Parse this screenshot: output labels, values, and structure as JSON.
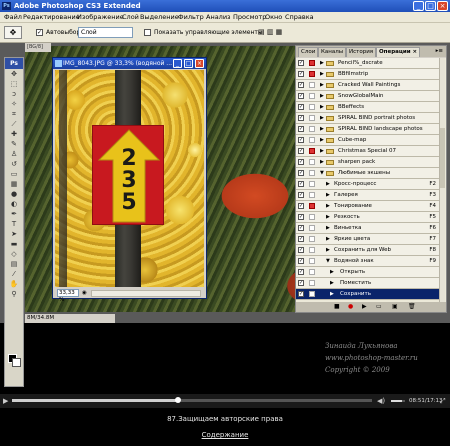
{
  "app": {
    "title": "Adobe Photoshop CS3 Extended",
    "logo": "Ps",
    "window_buttons": [
      "_",
      "□",
      "×"
    ]
  },
  "menu": [
    "Файл",
    "Редактирование",
    "Изображение",
    "Слой",
    "Выделение",
    "Фильтр",
    "Анализ",
    "Просмотр",
    "Окно",
    "Справка"
  ],
  "options": {
    "autoselect_label": "Автовыбор:",
    "autoselect_value": "Слой",
    "show_transform_label": "Показать управляющие элементы"
  },
  "background_doc": {
    "tab": "[BG/8]",
    "status": "8M/34.8M"
  },
  "document": {
    "title": "IMG_8043.JPG @ 33,3% (водяной ...",
    "zoom": "33,33 %",
    "sign_digits": [
      "2",
      "3",
      "5"
    ]
  },
  "panel": {
    "tabs": [
      "Слои",
      "Каналы",
      "История",
      "Операции ×"
    ],
    "rows": [
      {
        "label": "Pencil%_dscrate",
        "type": "set",
        "red": true
      },
      {
        "label": "BBfilmstrip",
        "type": "set",
        "red": true
      },
      {
        "label": "Cracked Wall Paintings",
        "type": "set",
        "red": false
      },
      {
        "label": "SnowGlobalMain",
        "type": "set",
        "red": false
      },
      {
        "label": "BBeffects",
        "type": "set",
        "red": false
      },
      {
        "label": "SPIRAL BIND portrait photos",
        "type": "set",
        "red": false
      },
      {
        "label": "SPIRAL BIND landscape photos",
        "type": "set",
        "red": false
      },
      {
        "label": "Cube-map",
        "type": "set",
        "red": false
      },
      {
        "label": "Christmas Special 07",
        "type": "set",
        "red": true
      },
      {
        "label": "sharpen pack",
        "type": "set",
        "red": false
      },
      {
        "label": "Любимые экшены",
        "type": "set-open",
        "red": false
      },
      {
        "label": "Кросс-процесс",
        "type": "action",
        "key": "F2",
        "red": false
      },
      {
        "label": "Галерея",
        "type": "action",
        "key": "F3",
        "red": false
      },
      {
        "label": "Тонирование",
        "type": "action",
        "key": "F4",
        "red": true
      },
      {
        "label": "Резкость",
        "type": "action",
        "key": "F5",
        "red": false
      },
      {
        "label": "Виньетка",
        "type": "action",
        "key": "F6",
        "red": false
      },
      {
        "label": "Яркие цвета",
        "type": "action",
        "key": "F7",
        "red": false
      },
      {
        "label": "Сохранить для Web",
        "type": "action",
        "key": "F8",
        "red": false
      },
      {
        "label": "Водяной знак",
        "type": "action-open",
        "key": "F9",
        "red": false
      },
      {
        "label": "Открыть",
        "type": "step",
        "red": false
      },
      {
        "label": "Поместить",
        "type": "step",
        "red": false
      },
      {
        "label": "Сохранить",
        "type": "step",
        "selected": true,
        "red": false
      }
    ],
    "bottom_icons": [
      "stop-icon",
      "record-icon",
      "play-icon",
      "new-set-icon",
      "new-action-icon",
      "trash-icon"
    ]
  },
  "watermark": {
    "name": "Зинаида Лукьянова",
    "site": "www.photoshop-master.ru",
    "copyright": "Copyright © 2009"
  },
  "player": {
    "progress": 0.46,
    "volume": 0.75,
    "time": "08:51/17:13"
  },
  "caption": "87.Защищаем авторские права",
  "contents_link": "Содержание"
}
